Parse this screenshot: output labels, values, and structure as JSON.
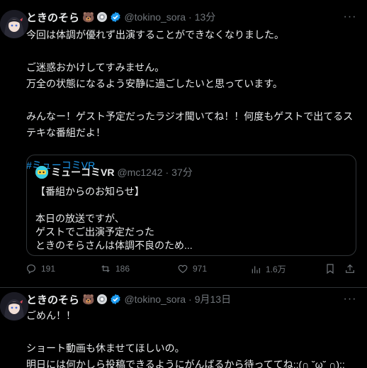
{
  "tweets": [
    {
      "display_name": "ときのそら",
      "name_emoji": "🐻",
      "handle": "@tokino_sora",
      "separator": "·",
      "time": "13分",
      "more": "···",
      "lines": [
        "今回は体調が優れず出演することができなくなりました。",
        "",
        "ご迷惑おかけしてすみません。",
        "万全の状態になるよう安静に過ごしたいと思っています。",
        "",
        "みんなー！ゲスト予定だったラジオ聞いてね！！何度もゲストで出てるステキな番組だよ！",
        ""
      ],
      "hashtag": "#ミューコミVR",
      "quote": {
        "display_name": "ミューコミVR",
        "handle": "@mc1242",
        "separator": "·",
        "time": "37分",
        "lines": [
          "【番組からのお知らせ】",
          "",
          "本日の放送ですが、",
          "ゲストでご出演予定だった",
          "ときのそらさんは体調不良のため..."
        ]
      },
      "actions": {
        "replies": "191",
        "reposts": "186",
        "likes": "971",
        "views": "1.6万"
      }
    },
    {
      "display_name": "ときのそら",
      "name_emoji": "🐻",
      "handle": "@tokino_sora",
      "separator": "·",
      "time": "9月13日",
      "more": "···",
      "lines": [
        "ごめん！！",
        "",
        "ショート動画も休ませてほしいの。",
        "明日には何かしら投稿できるようにがんばるから待っててね;;(∩ ˘ω˘ ∩);;"
      ]
    }
  ],
  "colors": {
    "background": "#000000",
    "text": "#e7e9ea",
    "muted": "#71767b",
    "accent": "#1d9bf0",
    "border": "#2f3336"
  },
  "icons": {
    "reply": "reply-icon",
    "repost": "repost-icon",
    "like": "like-icon",
    "views": "views-icon",
    "bookmark": "bookmark-icon",
    "share": "share-icon",
    "verified": "verified-badge-icon",
    "more": "more-icon"
  }
}
